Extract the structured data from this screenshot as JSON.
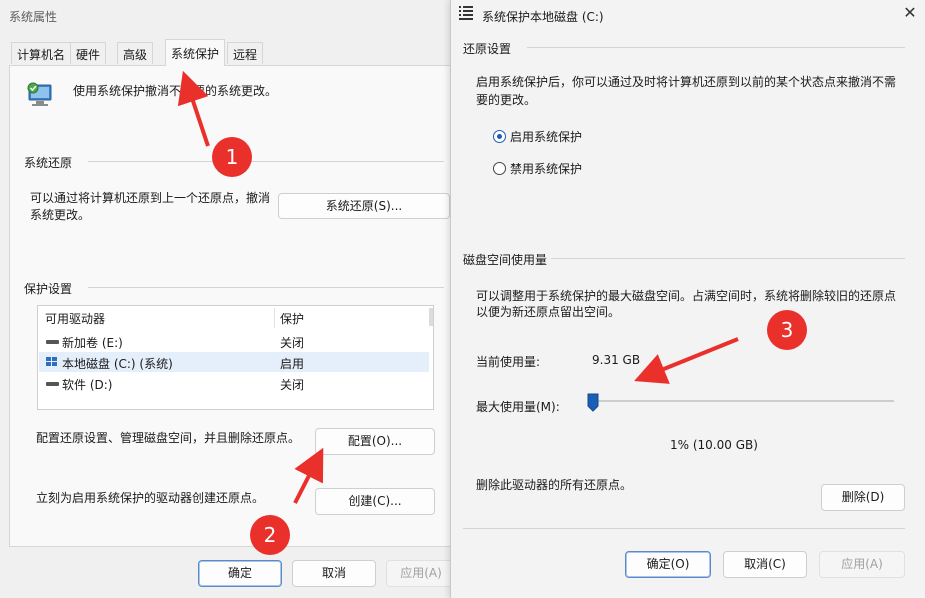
{
  "win1": {
    "title": "系统属性",
    "tabs": [
      "计算机名",
      "硬件",
      "高级",
      "系统保护",
      "远程"
    ],
    "info_text": "使用系统保护撤消不需要的系统更改。",
    "restore": {
      "group": "系统还原",
      "desc": "可以通过将计算机还原到上一个还原点，撤消系统更改。",
      "button": "系统还原(S)..."
    },
    "protect": {
      "group": "保护设置",
      "col_drive": "可用驱动器",
      "col_state": "保护",
      "drives": [
        {
          "name": "新加卷 (E:)",
          "state": "关闭"
        },
        {
          "name": "本地磁盘 (C:) (系统)",
          "state": "启用"
        },
        {
          "name": "软件 (D:)",
          "state": "关闭"
        }
      ],
      "config_text": "配置还原设置、管理磁盘空间，并且删除还原点。",
      "config_button": "配置(O)...",
      "create_text": "立刻为启用系统保护的驱动器创建还原点。",
      "create_button": "创建(C)..."
    },
    "ok": "确定",
    "cancel": "取消",
    "apply": "应用(A)"
  },
  "win2": {
    "title": "系统保护本地磁盘 (C:)",
    "close": "✕",
    "restore_section": "还原设置",
    "restore_desc_1": "启用系统保护后，你可以通过及时将计算机还原到以前的某个状态点来撤消不需",
    "restore_desc_2": "要的更改。",
    "radio_enable": "启用系统保护",
    "radio_disable": "禁用系统保护",
    "radio_selected": "启用系统保护",
    "disk_section": "磁盘空间使用量",
    "disk_desc_1": "可以调整用于系统保护的最大磁盘空间。占满空间时，系统将删除较旧的还原点",
    "disk_desc_2": "以便为新还原点留出空间。",
    "current_label": "当前使用量:",
    "current_value": "9.31 GB",
    "max_label": "最大使用量(M):",
    "max_value_fraction": 0.01,
    "max_value_text": "1% (10.00 GB)",
    "delete_text": "删除此驱动器的所有还原点。",
    "delete_button": "删除(D)",
    "ok": "确定(O)",
    "cancel": "取消(C)",
    "apply": "应用(A)"
  },
  "annotations": [
    "1",
    "2",
    "3"
  ],
  "colors": {
    "accent": "#1a5fb4",
    "annotation": "#e9302b"
  }
}
